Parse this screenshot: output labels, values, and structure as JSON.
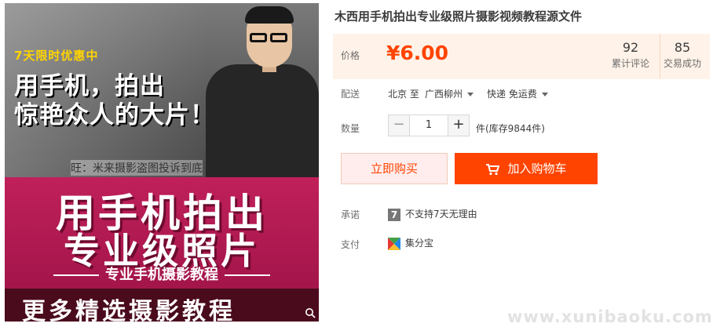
{
  "image": {
    "promo_tag": "7天限时优惠中",
    "headline_line1": "用手机，拍出",
    "headline_line2": "惊艳众人的大片！",
    "watermark": "旺：米来摄影盗图投诉到底",
    "big_line1": "用手机拍出",
    "big_line2": "专业级照片",
    "subtitle": "专业手机摄影教程",
    "footer_text": "更多精选摄影教程",
    "zoom_icon": "magnifier-icon"
  },
  "product": {
    "title": "木西用手机拍出专业级照片摄影视频教程源文件"
  },
  "price": {
    "label": "价格",
    "value": "¥6.00",
    "reviews_count": "92",
    "reviews_label": "累计评论",
    "deals_count": "85",
    "deals_label": "交易成功"
  },
  "delivery": {
    "label": "配送",
    "from": "北京 至",
    "to": "广西柳州",
    "shipping": "快递 免运费"
  },
  "quantity": {
    "label": "数量",
    "minus": "−",
    "value": "1",
    "plus": "+",
    "stock": "件(库存9844件)"
  },
  "actions": {
    "buy_now": "立即购买",
    "add_cart": "加入购物车"
  },
  "promise": {
    "label": "承诺",
    "badge": "7",
    "text": "不支持7天无理由"
  },
  "payment": {
    "label": "支付",
    "method": "集分宝"
  },
  "site_watermark": "www.xunibaoku.com",
  "colors": {
    "accent": "#ff4400",
    "price_bg": "#fff2e8"
  }
}
